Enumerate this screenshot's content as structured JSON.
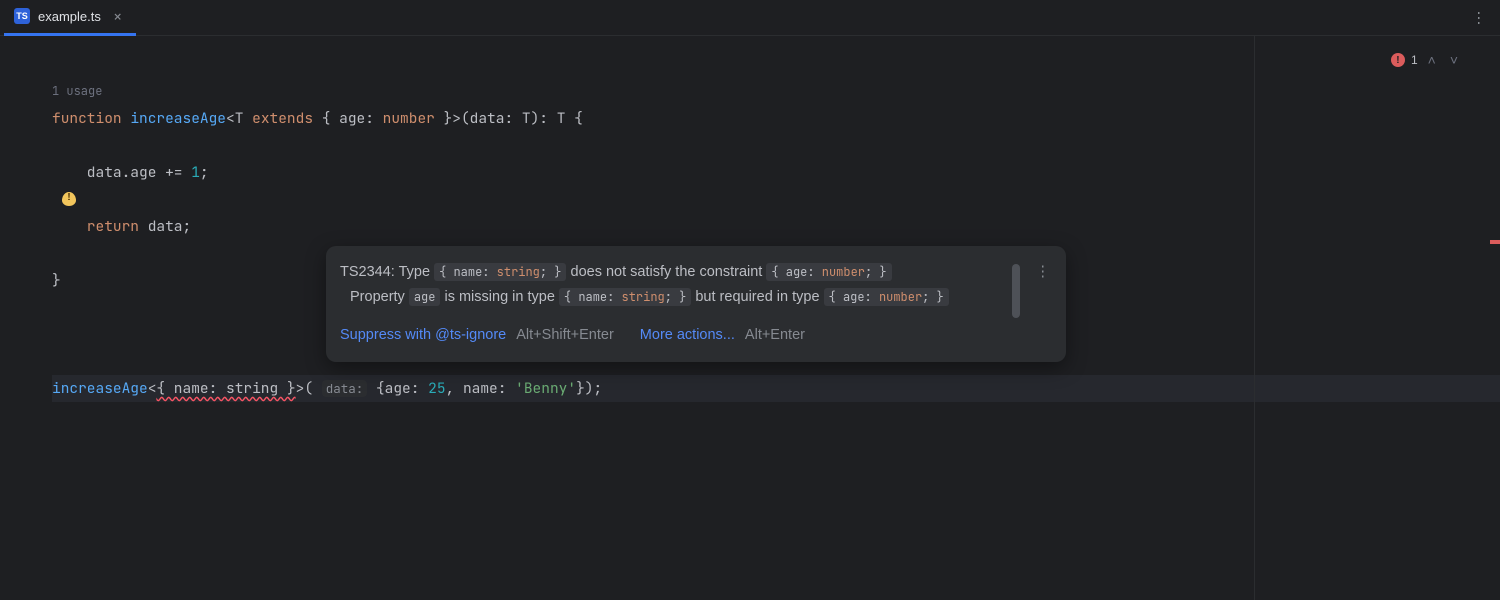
{
  "tab": {
    "file_name": "example.ts",
    "icon_text": "TS"
  },
  "inspection": {
    "error_count": "1"
  },
  "code": {
    "usage_hint": "1 usage",
    "l1": {
      "kw": "function ",
      "fn": "increaseAge",
      "generic_open": "<",
      "tp": "T ",
      "extends": "extends",
      "obj": " { age: ",
      "num_t": "number",
      "obj_close": " }>",
      "params_open": "(",
      "p1": "data",
      "colon": ": ",
      "p1t": "T",
      "params_close": ")",
      "ret": ": ",
      "rett": "T",
      "brace": " {"
    },
    "l2": {
      "body": "    data.age += ",
      "one": "1",
      "semi": ";"
    },
    "l3": {
      "ret": "    return ",
      "expr": "data;"
    },
    "l4": "}",
    "l6": {
      "call": "increaseAge",
      "lt": "<",
      "err": "{ name: string }",
      "gt": ">",
      "paren_o": "( ",
      "hint": "data:",
      "sp": " {",
      "k1": "age: ",
      "v1": "25",
      "c": ", ",
      "k2": "name: ",
      "v2": "'Benny'",
      "close": "});"
    }
  },
  "tooltip": {
    "err_code": "TS2344",
    "pre1": ": Type ",
    "type1_a": "{ name: ",
    "type1_kw": "string",
    "type1_b": "; }",
    "mid1": " does not satisfy the constraint ",
    "type2_a": "{ age: ",
    "type2_kw": "number",
    "type2_b": "; }",
    "line2a": "Property ",
    "prop": "age",
    "line2b": " is missing in type ",
    "line2c": " but required in type ",
    "suppress": "Suppress with @ts-ignore",
    "suppress_key": "Alt+Shift+Enter",
    "more": "More actions...",
    "more_key": "Alt+Enter"
  }
}
